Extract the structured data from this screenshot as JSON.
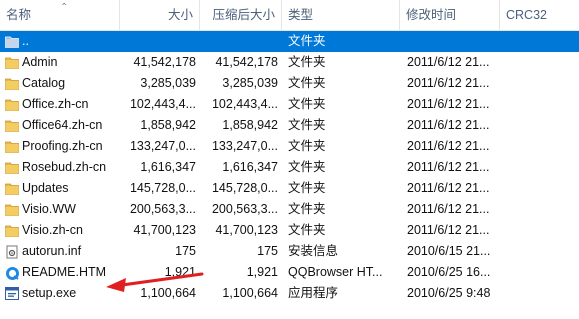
{
  "columns": {
    "name": "名称",
    "size": "大小",
    "compressed_size": "压缩后大小",
    "type": "类型",
    "modified": "修改时间",
    "crc": "CRC32"
  },
  "rows": [
    {
      "name": "..",
      "size": "",
      "compressed_size": "",
      "type": "文件夹",
      "modified": "",
      "crc": "",
      "icon": "folder-up-icon",
      "selected": true
    },
    {
      "name": "Admin",
      "size": "41,542,178",
      "compressed_size": "41,542,178",
      "type": "文件夹",
      "modified": "2011/6/12 21...",
      "crc": "",
      "icon": "folder-icon"
    },
    {
      "name": "Catalog",
      "size": "3,285,039",
      "compressed_size": "3,285,039",
      "type": "文件夹",
      "modified": "2011/6/12 21...",
      "crc": "",
      "icon": "folder-icon"
    },
    {
      "name": "Office.zh-cn",
      "size": "102,443,4...",
      "compressed_size": "102,443,4...",
      "type": "文件夹",
      "modified": "2011/6/12 21...",
      "crc": "",
      "icon": "folder-icon"
    },
    {
      "name": "Office64.zh-cn",
      "size": "1,858,942",
      "compressed_size": "1,858,942",
      "type": "文件夹",
      "modified": "2011/6/12 21...",
      "crc": "",
      "icon": "folder-icon"
    },
    {
      "name": "Proofing.zh-cn",
      "size": "133,247,0...",
      "compressed_size": "133,247,0...",
      "type": "文件夹",
      "modified": "2011/6/12 21...",
      "crc": "",
      "icon": "folder-icon"
    },
    {
      "name": "Rosebud.zh-cn",
      "size": "1,616,347",
      "compressed_size": "1,616,347",
      "type": "文件夹",
      "modified": "2011/6/12 21...",
      "crc": "",
      "icon": "folder-icon"
    },
    {
      "name": "Updates",
      "size": "145,728,0...",
      "compressed_size": "145,728,0...",
      "type": "文件夹",
      "modified": "2011/6/12 21...",
      "crc": "",
      "icon": "folder-icon"
    },
    {
      "name": "Visio.WW",
      "size": "200,563,3...",
      "compressed_size": "200,563,3...",
      "type": "文件夹",
      "modified": "2011/6/12 21...",
      "crc": "",
      "icon": "folder-icon"
    },
    {
      "name": "Visio.zh-cn",
      "size": "41,700,123",
      "compressed_size": "41,700,123",
      "type": "文件夹",
      "modified": "2011/6/12 21...",
      "crc": "",
      "icon": "folder-icon"
    },
    {
      "name": "autorun.inf",
      "size": "175",
      "compressed_size": "175",
      "type": "安装信息",
      "modified": "2010/6/15 21...",
      "crc": "",
      "icon": "settings-file-icon"
    },
    {
      "name": "README.HTM",
      "size": "1,921",
      "compressed_size": "1,921",
      "type": "QQBrowser HT...",
      "modified": "2010/6/25 16...",
      "crc": "",
      "icon": "browser-icon"
    },
    {
      "name": "setup.exe",
      "size": "1,100,664",
      "compressed_size": "1,100,664",
      "type": "应用程序",
      "modified": "2010/6/25 9:48",
      "crc": "",
      "icon": "exe-icon"
    }
  ],
  "colors": {
    "selection": "#0078d7",
    "folder": "#e8b84a",
    "header_text": "#4c607a",
    "arrow": "#e02020"
  }
}
